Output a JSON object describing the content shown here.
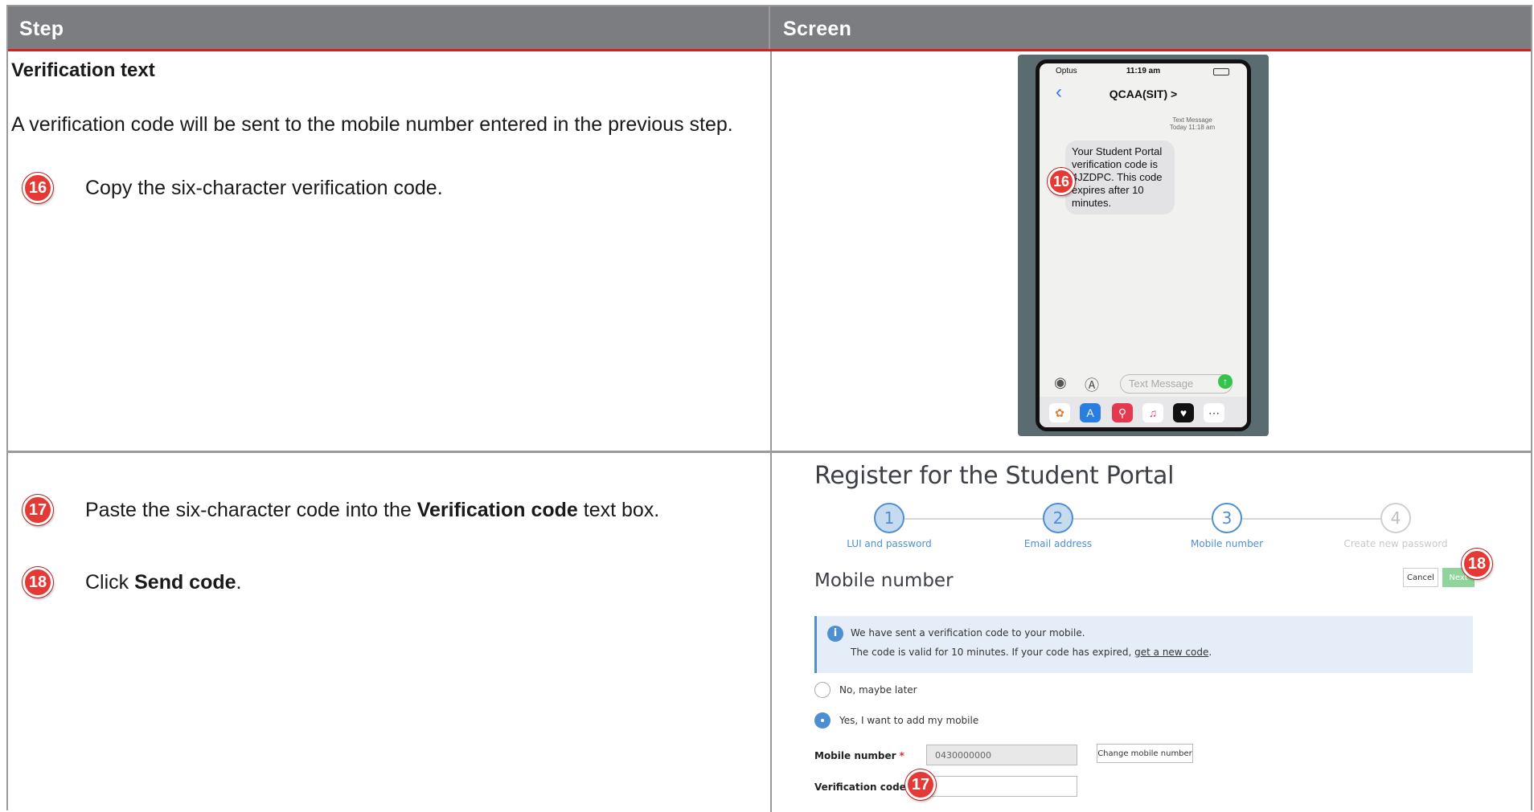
{
  "header": {
    "step": "Step",
    "screen": "Screen"
  },
  "row1": {
    "title": "Verification text",
    "paragraph": "A verification code will be sent to the mobile number entered in the previous step.",
    "steps": [
      {
        "num": "16",
        "text": "Copy the six-character verification code."
      }
    ]
  },
  "row2": {
    "step17": {
      "num": "17",
      "pre": "Paste the six-character code into the ",
      "bold": "Verification code",
      "post": " text box."
    },
    "step18": {
      "num": "18",
      "pre": "Click ",
      "bold": "Send code",
      "post": "."
    }
  },
  "phone": {
    "carrier": "Optus",
    "time": "11:19 am",
    "contact": "QCAA(SIT) >",
    "meta_line1": "Text Message",
    "meta_line2": "Today 11:18 am",
    "message": "Your Student Portal verification code is 4JZDPC. This code expires after 10 minutes.",
    "badge": "16",
    "input_placeholder": "Text Message"
  },
  "portal": {
    "title": "Register for the Student Portal",
    "wizard": [
      {
        "num": "1",
        "label": "LUI and password",
        "state": "done"
      },
      {
        "num": "2",
        "label": "Email address",
        "state": "done"
      },
      {
        "num": "3",
        "label": "Mobile number",
        "state": "current"
      },
      {
        "num": "4",
        "label": "Create new password",
        "state": "future"
      }
    ],
    "section_title": "Mobile number",
    "cancel_label": "Cancel",
    "next_label": "Next",
    "next_badge": "18",
    "info_line1": "We have sent a verification code to your mobile.",
    "info_line2_pre": "The code is valid for 10 minutes. If your code has expired, ",
    "info_link": "get a new code",
    "info_line2_post": ".",
    "radio_no": "No, maybe later",
    "radio_yes": "Yes, I want to add my mobile",
    "mobile_label": "Mobile number",
    "mobile_value": "0430000000",
    "change_label": "Change mobile number",
    "code_label": "Verification code",
    "code_value": "",
    "code_badge": "17",
    "required_mark": "*"
  },
  "colors": {
    "header_bg": "#7b7d80",
    "header_rule": "#d7201d",
    "badge": "#e53935",
    "accent": "#4e8fd1",
    "next_button": "#8fd59b"
  }
}
